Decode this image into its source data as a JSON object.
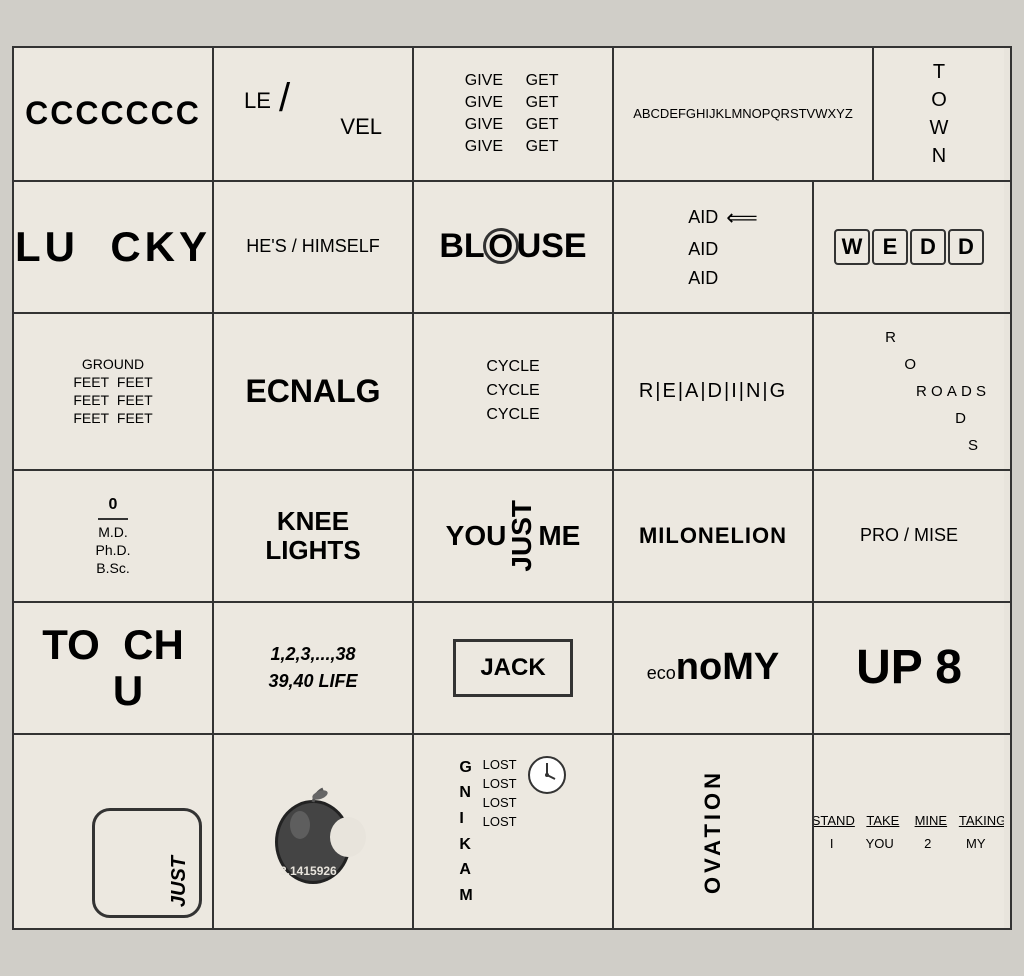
{
  "rows": [
    {
      "id": "row1",
      "cells": [
        {
          "id": "r1c1",
          "type": "ccccc",
          "text": "CCCCCCC"
        },
        {
          "id": "r1c2",
          "type": "level",
          "top": "LE",
          "bot": "VEL",
          "slash": "/"
        },
        {
          "id": "r1c3",
          "type": "give-get",
          "pairs": [
            [
              "GIVE",
              "GET"
            ],
            [
              "GIVE",
              "GET"
            ],
            [
              "GIVE",
              "GET"
            ],
            [
              "GIVE",
              "GET"
            ]
          ]
        },
        {
          "id": "r1c4",
          "type": "alphabet",
          "text": "ABCDEFGHIJKLMNOPQRSTVWXYZ"
        },
        {
          "id": "r1c5",
          "type": "town",
          "letters": [
            "T",
            "O",
            "W",
            "N"
          ]
        }
      ]
    },
    {
      "id": "row2",
      "cells": [
        {
          "id": "r2c1",
          "type": "lucky",
          "text": "LU  CKY"
        },
        {
          "id": "r2c2",
          "type": "hes",
          "text": "HE'S / HIMSELF"
        },
        {
          "id": "r2c3",
          "type": "blouse",
          "pre": "BL",
          "letter": "O",
          "post": "USE"
        },
        {
          "id": "r2c4",
          "type": "aid",
          "items": [
            "AID →",
            "AID",
            "AID"
          ]
        },
        {
          "id": "r2c5",
          "type": "ddd",
          "letters": [
            "W",
            "E",
            "D",
            "D"
          ]
        }
      ]
    },
    {
      "id": "row3",
      "cells": [
        {
          "id": "r3c1",
          "type": "ground",
          "lines": [
            "GROUND",
            "FEET  FEET",
            "FEET  FEET",
            "FEET  FEET"
          ]
        },
        {
          "id": "r3c2",
          "type": "ecnalg",
          "text": "ECNALG"
        },
        {
          "id": "r3c3",
          "type": "cycle",
          "items": [
            "CYCLE",
            "CYCLE",
            "CYCLE"
          ]
        },
        {
          "id": "r3c4",
          "type": "reading",
          "text": "R|E|A|D|I|N|G"
        },
        {
          "id": "r3c5",
          "type": "roads",
          "letters": [
            "R",
            "O",
            "A D S",
            "D",
            "S"
          ]
        }
      ]
    },
    {
      "id": "row4",
      "cells": [
        {
          "id": "r4c1",
          "type": "degrees",
          "zero": "0",
          "items": [
            "M.D.",
            "Ph.D.",
            "B.Sc."
          ]
        },
        {
          "id": "r4c2",
          "type": "knee",
          "lines": [
            "KNEE",
            "LIGHTS"
          ]
        },
        {
          "id": "r4c3",
          "type": "youjustme",
          "left": "YOU",
          "middle": "JUST",
          "right": "ME"
        },
        {
          "id": "r4c4",
          "type": "milonelion",
          "text": "MILONELION"
        },
        {
          "id": "r4c5",
          "type": "promise",
          "text": "PRO / MISE"
        }
      ]
    },
    {
      "id": "row5",
      "cells": [
        {
          "id": "r5c1",
          "type": "touch",
          "top": "TO  CH",
          "bot": "U"
        },
        {
          "id": "r5c2",
          "type": "life",
          "line1": "1,2,3,...,38",
          "line2": "39,40  LIFE"
        },
        {
          "id": "r5c3",
          "type": "jack",
          "text": "JACK"
        },
        {
          "id": "r5c4",
          "type": "economy",
          "small": "eco",
          "large": "noMY"
        },
        {
          "id": "r5c5",
          "type": "up8",
          "text": "UP 8"
        }
      ]
    },
    {
      "id": "row6",
      "cells": [
        {
          "id": "r6c1",
          "type": "justbox",
          "text": "JUST"
        },
        {
          "id": "r6c2",
          "type": "apple",
          "number": "3.1415926"
        },
        {
          "id": "r6c3",
          "type": "gnikam",
          "letters": [
            "G",
            "N",
            "I",
            "K",
            "A",
            "M"
          ],
          "lost": [
            "LOST",
            "LOST",
            "LOST",
            "LOST"
          ]
        },
        {
          "id": "r6c4",
          "type": "ovation",
          "text": "OVATION"
        },
        {
          "id": "r6c5",
          "type": "stand",
          "row1": [
            "STAND",
            "TAKE",
            "MINE",
            "TAKING"
          ],
          "row2": [
            "I",
            "YOU",
            "2",
            "MY"
          ]
        }
      ]
    }
  ]
}
